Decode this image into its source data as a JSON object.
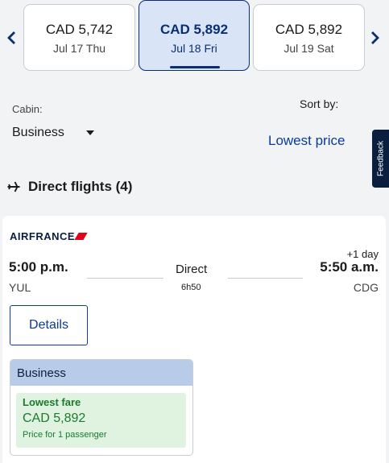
{
  "date_nav": {
    "prev_icon": "chevron-left-icon",
    "next_icon": "chevron-right-icon",
    "dates": [
      {
        "price": "CAD 5,742",
        "date": "Jul 17 Thu",
        "selected": false
      },
      {
        "price": "CAD 5,892",
        "date": "Jul 18 Fri",
        "selected": true
      },
      {
        "price": "CAD 5,892",
        "date": "Jul 19 Sat",
        "selected": false
      }
    ]
  },
  "filters": {
    "cabin_label": "Cabin:",
    "cabin_value": "Business",
    "sort_label": "Sort by:",
    "sort_value": "Lowest price"
  },
  "feedback": "Feedback",
  "section": {
    "icon": "airplane-icon",
    "title": "Direct flights (4)"
  },
  "flight": {
    "airline": "AIRFRANCE",
    "departure_time": "5:00 p.m.",
    "departure_code": "YUL",
    "stops": "Direct",
    "duration": "6h50",
    "day_offset": "+1 day",
    "arrival_time": "5:50 a.m.",
    "arrival_code": "CDG",
    "details_label": "Details",
    "fare": {
      "cabin": "Business",
      "tag": "Lowest fare",
      "price": "CAD 5,892",
      "note": "Price for 1 passenger"
    }
  },
  "colors": {
    "brand_navy": "#0a2e73",
    "link_blue": "#0a3a9a",
    "fare_green": "#1b7a2e",
    "fare_green_bg": "#e0f3e0",
    "cabin_header_bg": "#b8cbe9",
    "airline_red": "#e2001a"
  }
}
